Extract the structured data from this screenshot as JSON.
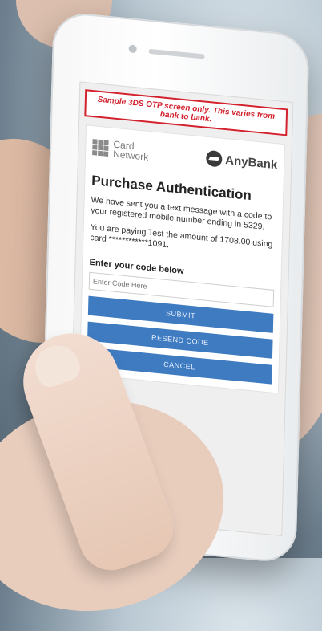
{
  "screen": {
    "banner": "Sample 3DS OTP screen only. This varies from bank to bank.",
    "logos": {
      "network_line1": "Card",
      "network_line2": "Network",
      "network_icon": "grid-icon",
      "bank_name": "AnyBank",
      "bank_icon": "bank-logo-icon"
    },
    "title": "Purchase Authentication",
    "message": "We have sent you a text message with a code to your registered mobile number ending in 5329.",
    "payment": "You are paying Test the amount of 1708.00 using card ************1091.",
    "code_label": "Enter your code below",
    "code_placeholder": "Enter Code Here",
    "buttons": {
      "submit": "SUBMIT",
      "resend": "RESEND CODE",
      "cancel": "CANCEL"
    }
  },
  "colors": {
    "accent": "#3f7bc1",
    "warning": "#d3222e"
  }
}
